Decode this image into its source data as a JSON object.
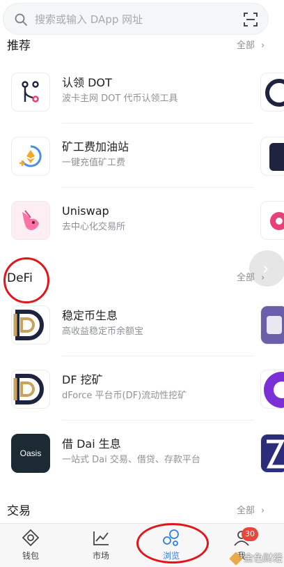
{
  "search": {
    "placeholder": "搜索或输入 DApp 网址"
  },
  "sections": [
    {
      "title": "推荐",
      "more_label": "全部",
      "chevron": "›"
    },
    {
      "title": "DeFi",
      "more_label": "全部",
      "chevron": "›"
    },
    {
      "title": "交易",
      "more_label": "全部",
      "chevron": "›"
    }
  ],
  "recommend_items": [
    {
      "name": "认领 DOT",
      "desc": "波卡主网 DOT 代币认领工具",
      "icon": "fork-icon"
    },
    {
      "name": "矿工费加油站",
      "desc": "一键充值矿工费",
      "icon": "gas-station-icon"
    },
    {
      "name": "Uniswap",
      "desc": "去中心化交易所",
      "icon": "unicorn-icon"
    }
  ],
  "defi_items": [
    {
      "name": "稳定币生息",
      "desc": "高收益稳定币余额宝",
      "icon": "dforce-d-icon"
    },
    {
      "name": "DF 挖矿",
      "desc": "dForce 平台币(DF)流动性挖矿",
      "icon": "dforce-d-icon"
    },
    {
      "name": "借 Dai 生息",
      "desc": "一站式 Dai 交易、借贷、存款平台",
      "icon": "oasis-icon",
      "icon_text": "Oasis"
    }
  ],
  "tabs": [
    {
      "label": "钱包",
      "icon": "wallet-diamond-icon",
      "active": false
    },
    {
      "label": "市场",
      "icon": "market-chart-icon",
      "active": false
    },
    {
      "label": "浏览",
      "icon": "browse-bubbles-icon",
      "active": true
    },
    {
      "label": "我",
      "icon": "profile-icon",
      "active": false,
      "badge": "30"
    }
  ],
  "watermark": {
    "text": "金色财经"
  },
  "colors": {
    "accent": "#2f7de9",
    "badge": "#e8453c",
    "annotation_red": "#e0161b",
    "dforce_gold": "#c9a25b",
    "dforce_navy": "#1e2340",
    "oasis_bg": "#1b2a33",
    "uniswap_pink": "#e8417a"
  }
}
